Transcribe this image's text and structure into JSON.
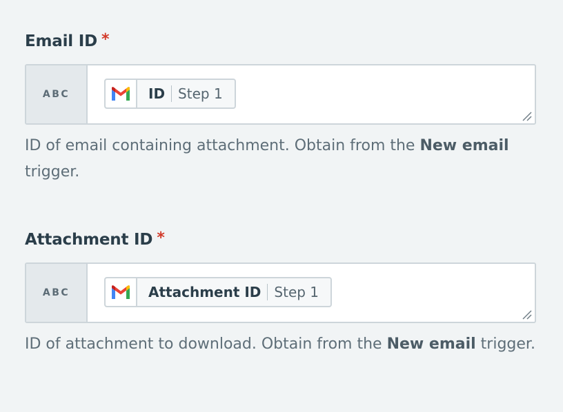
{
  "fields": [
    {
      "label": "Email ID",
      "required_mark": "*",
      "type_label": "ABC",
      "pill": {
        "icon": "gmail-icon",
        "field": "ID",
        "step": "Step 1"
      },
      "help_prefix": "ID of email containing attachment. Obtain from the ",
      "help_strong": "New email",
      "help_suffix": " trigger."
    },
    {
      "label": "Attachment ID",
      "required_mark": "*",
      "type_label": "ABC",
      "pill": {
        "icon": "gmail-icon",
        "field": "Attachment ID",
        "step": "Step 1"
      },
      "help_prefix": "ID of attachment to download. Obtain from the ",
      "help_strong": "New email",
      "help_suffix": " trigger."
    }
  ],
  "colors": {
    "page_background": "#f1f4f5",
    "required": "#d23a2a",
    "label_text": "#2b3e4a",
    "help_text": "#5e6e78",
    "border": "#cdd5da"
  }
}
